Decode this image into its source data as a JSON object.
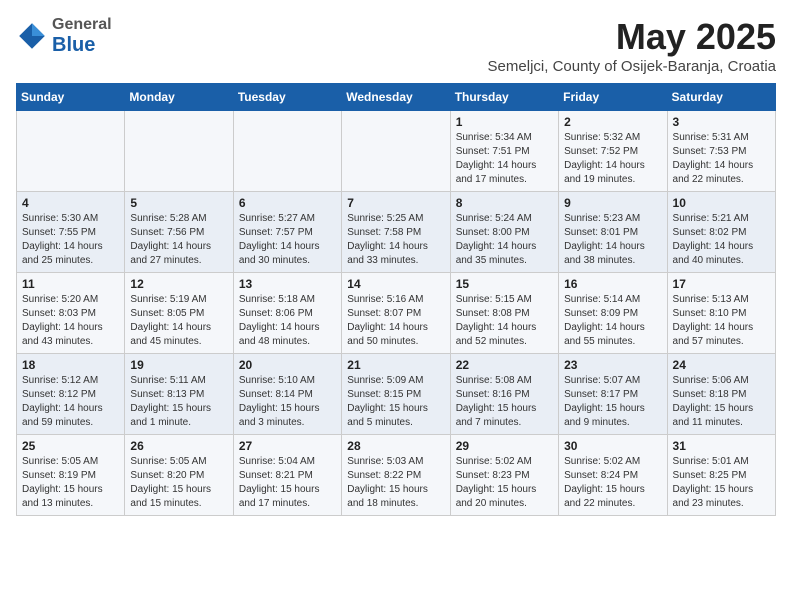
{
  "logo": {
    "general": "General",
    "blue": "Blue"
  },
  "title": "May 2025",
  "subtitle": "Semeljci, County of Osijek-Baranja, Croatia",
  "days_of_week": [
    "Sunday",
    "Monday",
    "Tuesday",
    "Wednesday",
    "Thursday",
    "Friday",
    "Saturday"
  ],
  "weeks": [
    [
      {
        "day": "",
        "info": ""
      },
      {
        "day": "",
        "info": ""
      },
      {
        "day": "",
        "info": ""
      },
      {
        "day": "",
        "info": ""
      },
      {
        "day": "1",
        "info": "Sunrise: 5:34 AM\nSunset: 7:51 PM\nDaylight: 14 hours\nand 17 minutes."
      },
      {
        "day": "2",
        "info": "Sunrise: 5:32 AM\nSunset: 7:52 PM\nDaylight: 14 hours\nand 19 minutes."
      },
      {
        "day": "3",
        "info": "Sunrise: 5:31 AM\nSunset: 7:53 PM\nDaylight: 14 hours\nand 22 minutes."
      }
    ],
    [
      {
        "day": "4",
        "info": "Sunrise: 5:30 AM\nSunset: 7:55 PM\nDaylight: 14 hours\nand 25 minutes."
      },
      {
        "day": "5",
        "info": "Sunrise: 5:28 AM\nSunset: 7:56 PM\nDaylight: 14 hours\nand 27 minutes."
      },
      {
        "day": "6",
        "info": "Sunrise: 5:27 AM\nSunset: 7:57 PM\nDaylight: 14 hours\nand 30 minutes."
      },
      {
        "day": "7",
        "info": "Sunrise: 5:25 AM\nSunset: 7:58 PM\nDaylight: 14 hours\nand 33 minutes."
      },
      {
        "day": "8",
        "info": "Sunrise: 5:24 AM\nSunset: 8:00 PM\nDaylight: 14 hours\nand 35 minutes."
      },
      {
        "day": "9",
        "info": "Sunrise: 5:23 AM\nSunset: 8:01 PM\nDaylight: 14 hours\nand 38 minutes."
      },
      {
        "day": "10",
        "info": "Sunrise: 5:21 AM\nSunset: 8:02 PM\nDaylight: 14 hours\nand 40 minutes."
      }
    ],
    [
      {
        "day": "11",
        "info": "Sunrise: 5:20 AM\nSunset: 8:03 PM\nDaylight: 14 hours\nand 43 minutes."
      },
      {
        "day": "12",
        "info": "Sunrise: 5:19 AM\nSunset: 8:05 PM\nDaylight: 14 hours\nand 45 minutes."
      },
      {
        "day": "13",
        "info": "Sunrise: 5:18 AM\nSunset: 8:06 PM\nDaylight: 14 hours\nand 48 minutes."
      },
      {
        "day": "14",
        "info": "Sunrise: 5:16 AM\nSunset: 8:07 PM\nDaylight: 14 hours\nand 50 minutes."
      },
      {
        "day": "15",
        "info": "Sunrise: 5:15 AM\nSunset: 8:08 PM\nDaylight: 14 hours\nand 52 minutes."
      },
      {
        "day": "16",
        "info": "Sunrise: 5:14 AM\nSunset: 8:09 PM\nDaylight: 14 hours\nand 55 minutes."
      },
      {
        "day": "17",
        "info": "Sunrise: 5:13 AM\nSunset: 8:10 PM\nDaylight: 14 hours\nand 57 minutes."
      }
    ],
    [
      {
        "day": "18",
        "info": "Sunrise: 5:12 AM\nSunset: 8:12 PM\nDaylight: 14 hours\nand 59 minutes."
      },
      {
        "day": "19",
        "info": "Sunrise: 5:11 AM\nSunset: 8:13 PM\nDaylight: 15 hours\nand 1 minute."
      },
      {
        "day": "20",
        "info": "Sunrise: 5:10 AM\nSunset: 8:14 PM\nDaylight: 15 hours\nand 3 minutes."
      },
      {
        "day": "21",
        "info": "Sunrise: 5:09 AM\nSunset: 8:15 PM\nDaylight: 15 hours\nand 5 minutes."
      },
      {
        "day": "22",
        "info": "Sunrise: 5:08 AM\nSunset: 8:16 PM\nDaylight: 15 hours\nand 7 minutes."
      },
      {
        "day": "23",
        "info": "Sunrise: 5:07 AM\nSunset: 8:17 PM\nDaylight: 15 hours\nand 9 minutes."
      },
      {
        "day": "24",
        "info": "Sunrise: 5:06 AM\nSunset: 8:18 PM\nDaylight: 15 hours\nand 11 minutes."
      }
    ],
    [
      {
        "day": "25",
        "info": "Sunrise: 5:05 AM\nSunset: 8:19 PM\nDaylight: 15 hours\nand 13 minutes."
      },
      {
        "day": "26",
        "info": "Sunrise: 5:05 AM\nSunset: 8:20 PM\nDaylight: 15 hours\nand 15 minutes."
      },
      {
        "day": "27",
        "info": "Sunrise: 5:04 AM\nSunset: 8:21 PM\nDaylight: 15 hours\nand 17 minutes."
      },
      {
        "day": "28",
        "info": "Sunrise: 5:03 AM\nSunset: 8:22 PM\nDaylight: 15 hours\nand 18 minutes."
      },
      {
        "day": "29",
        "info": "Sunrise: 5:02 AM\nSunset: 8:23 PM\nDaylight: 15 hours\nand 20 minutes."
      },
      {
        "day": "30",
        "info": "Sunrise: 5:02 AM\nSunset: 8:24 PM\nDaylight: 15 hours\nand 22 minutes."
      },
      {
        "day": "31",
        "info": "Sunrise: 5:01 AM\nSunset: 8:25 PM\nDaylight: 15 hours\nand 23 minutes."
      }
    ]
  ]
}
